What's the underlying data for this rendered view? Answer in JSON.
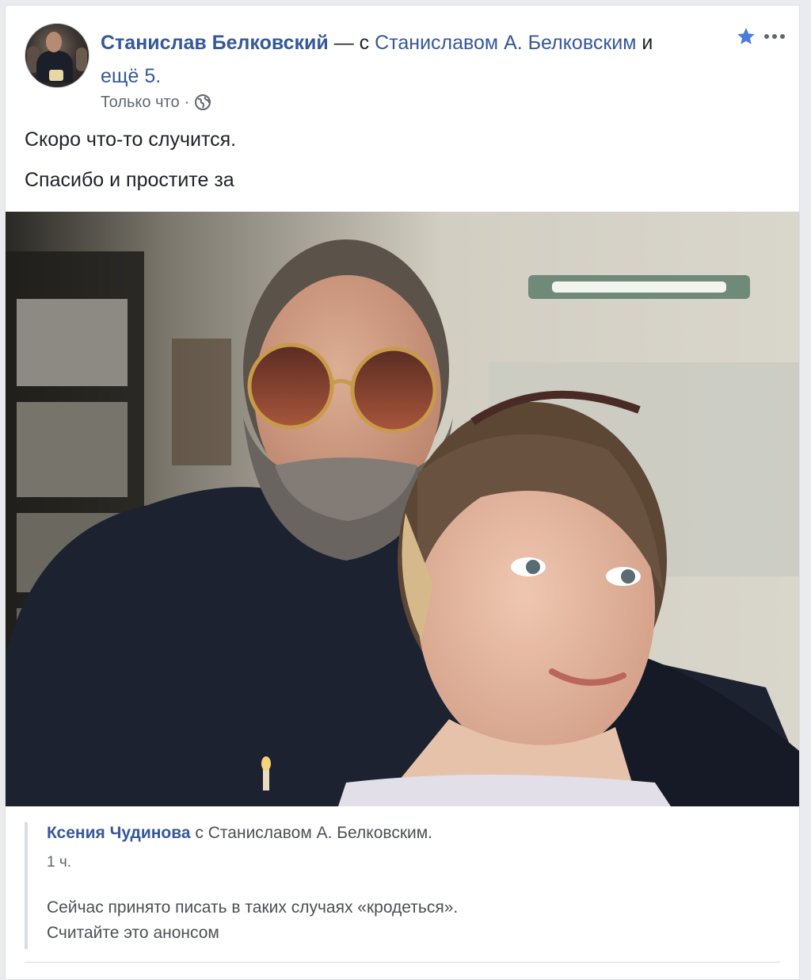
{
  "post": {
    "author": "Станислав Белковский",
    "with_prefix": "— с",
    "tagged_person": "Станиславом А. Белковским",
    "and_word": "и",
    "more_tagged": "ещё 5.",
    "timestamp": "Только что",
    "separator": "·",
    "privacy_icon": "globe-icon",
    "text_lines": [
      "Скоро что-то случится.",
      "Спасибо и простите за"
    ],
    "actions": {
      "favorite_icon": "star-icon",
      "menu_icon": "more-horizontal-icon"
    }
  },
  "shared_post": {
    "author": "Ксения Чудинова",
    "with_text": "с Станиславом А. Белковским.",
    "timestamp": "1 ч.",
    "text_lines": [
      "Сейчас принято писать в таких случаях «кродеться».",
      "Считайте это анонсом"
    ]
  },
  "colors": {
    "link": "#365899",
    "text": "#1d2129",
    "meta": "#616770",
    "star": "#4a7cdb"
  }
}
